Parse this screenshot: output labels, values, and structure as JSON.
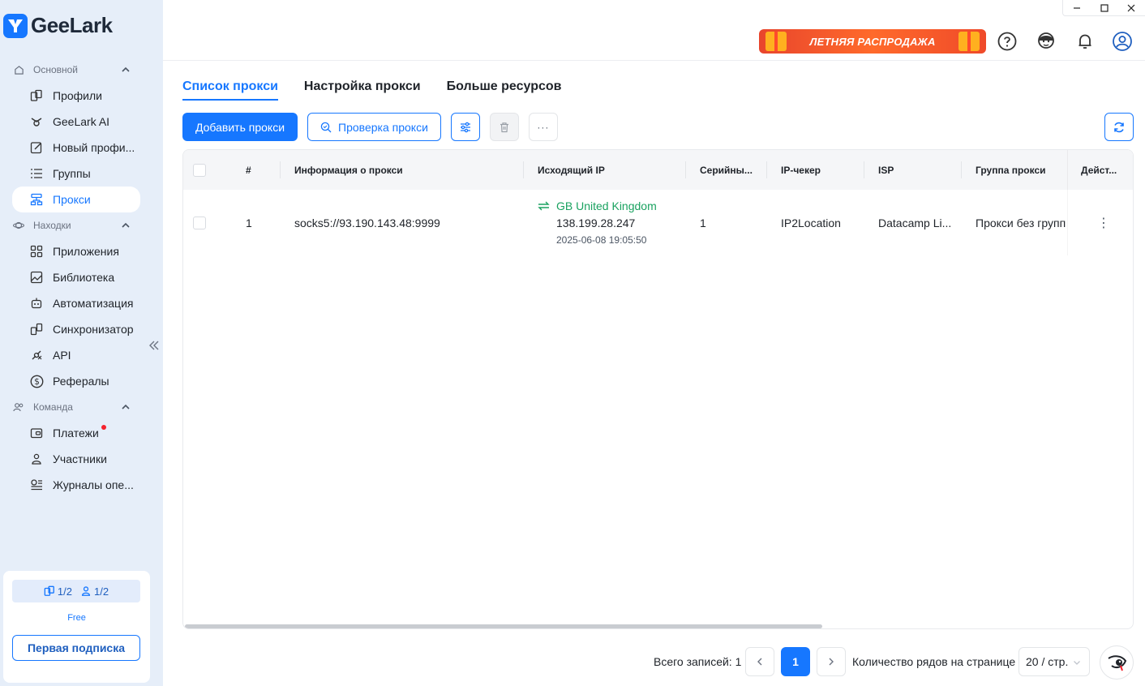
{
  "app": {
    "name": "GeeLark"
  },
  "window": {
    "minimize": "—",
    "maximize": "☐",
    "close": "✕"
  },
  "sidebar": {
    "sections": [
      {
        "label": "Основной",
        "items": [
          {
            "label": "Профили",
            "icon": "profiles-icon"
          },
          {
            "label": "GeeLark AI",
            "icon": "ai-icon"
          },
          {
            "label": "Новый профи...",
            "icon": "new-profile-icon"
          },
          {
            "label": "Группы",
            "icon": "groups-icon"
          },
          {
            "label": "Прокси",
            "icon": "proxy-icon",
            "active": true
          }
        ]
      },
      {
        "label": "Находки",
        "items": [
          {
            "label": "Приложения",
            "icon": "apps-icon"
          },
          {
            "label": "Библиотека",
            "icon": "library-icon"
          },
          {
            "label": "Автоматизация",
            "icon": "automation-icon"
          },
          {
            "label": "Синхронизатор",
            "icon": "synchronizer-icon"
          },
          {
            "label": "API",
            "icon": "api-icon"
          },
          {
            "label": "Рефералы",
            "icon": "referrals-icon"
          }
        ]
      },
      {
        "label": "Команда",
        "items": [
          {
            "label": "Платежи",
            "icon": "payments-icon",
            "badge_dot": true
          },
          {
            "label": "Участники",
            "icon": "members-icon"
          },
          {
            "label": "Журналы опе...",
            "icon": "logs-icon"
          }
        ]
      }
    ],
    "plan": {
      "profiles": "1/2",
      "members": "1/2",
      "tier": "Free",
      "subscribe_label": "Первая подписка"
    }
  },
  "header": {
    "promo_label": "ЛЕТНЯЯ РАСПРОДАЖА"
  },
  "tabs": [
    {
      "label": "Список прокси",
      "active": true
    },
    {
      "label": "Настройка прокси"
    },
    {
      "label": "Больше ресурсов"
    }
  ],
  "toolbar": {
    "add_label": "Добавить прокси",
    "check_label": "Проверка прокси",
    "more_label": "···"
  },
  "table": {
    "columns": [
      "#",
      "Информация о прокси",
      "Исходящий IP",
      "Серийны...",
      "IP-чекер",
      "ISP",
      "Группа прокси",
      "Дейст..."
    ],
    "rows": [
      {
        "index": "1",
        "proxy_info": "socks5://93.190.143.48:9999",
        "country": "GB United Kingdom",
        "ip": "138.199.28.247",
        "checked_at": "2025-06-08 19:05:50",
        "serial": "1",
        "ip_checker": "IP2Location",
        "isp": "Datacamp Li...",
        "group": "Прокси без групп",
        "action": "⋮"
      }
    ]
  },
  "pagination": {
    "total_label": "Всего записей: 1",
    "current_page": "1",
    "rows_label": "Количество рядов на странице",
    "page_size": "20 / стр."
  },
  "colors": {
    "accent": "#1677ff",
    "success": "#1aa260",
    "sidebar_bg": "#e6eef9"
  }
}
